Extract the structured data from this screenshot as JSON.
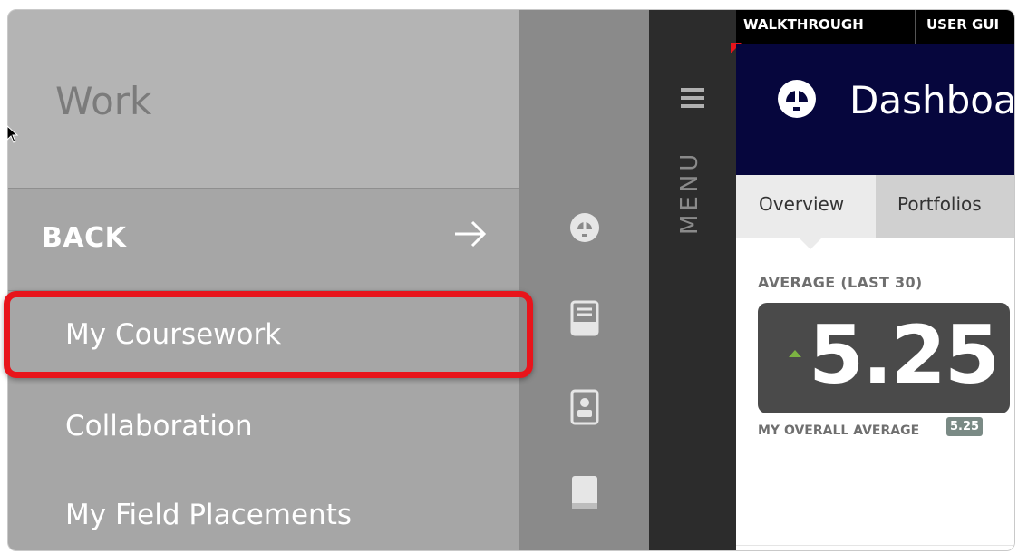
{
  "side_panel": {
    "title": "Work",
    "back_label": "BACK",
    "items": [
      {
        "label": "My Coursework"
      },
      {
        "label": "Collaboration"
      },
      {
        "label": "My Field Placements"
      }
    ]
  },
  "menu_bar": {
    "label": "MENU"
  },
  "top_nav": {
    "tabs": [
      {
        "label": "WALKTHROUGH"
      },
      {
        "label": "USER GUI"
      }
    ]
  },
  "header": {
    "title": "Dashboa"
  },
  "tabs": [
    {
      "label": "Overview"
    },
    {
      "label": "Portfolios"
    }
  ],
  "stats": {
    "average_label": "AVERAGE (LAST 30)",
    "average_value": "5.25",
    "overall_label": "MY OVERALL AVERAGE",
    "overall_value": "5.25"
  },
  "icons": {
    "strip": [
      "dashboard-icon",
      "inbox-icon",
      "contact-card-icon",
      "book-icon"
    ],
    "back": "arrow-right-icon",
    "menu": "hamburger-icon"
  },
  "colors": {
    "highlight": "#e8141b",
    "header_bg": "#06063d",
    "trend_up": "#7cb342"
  }
}
